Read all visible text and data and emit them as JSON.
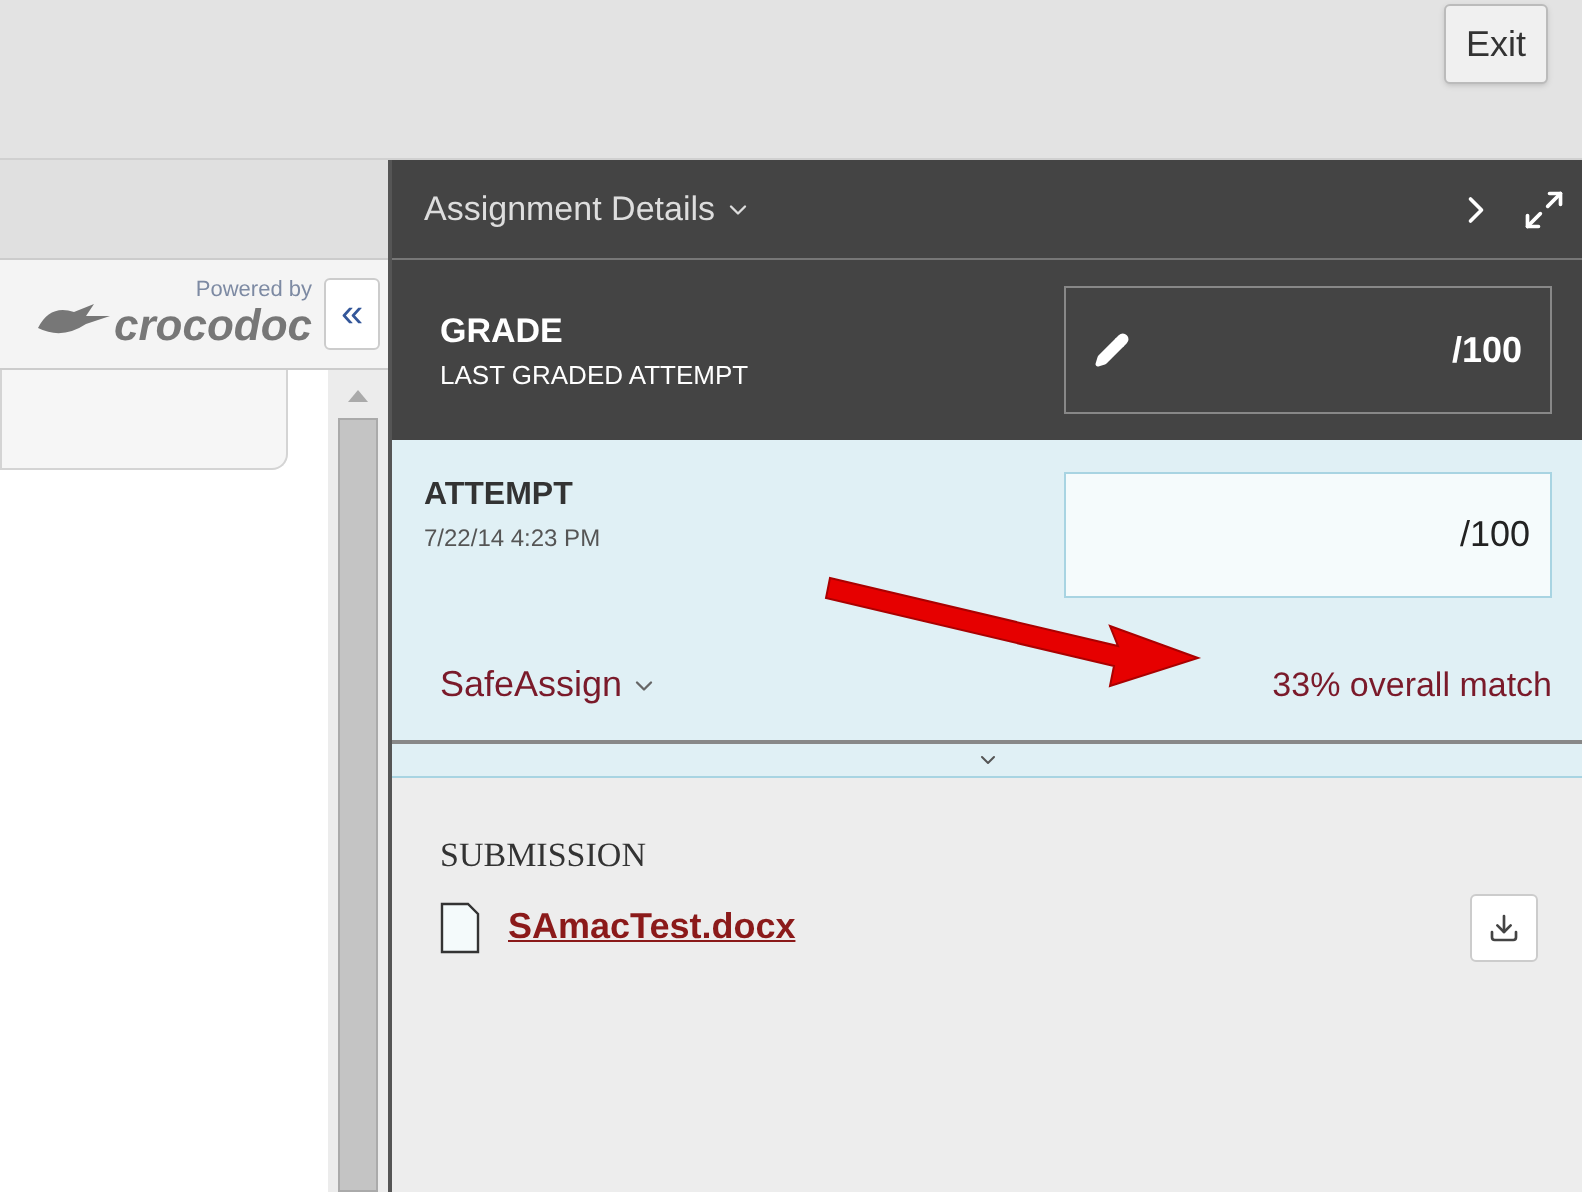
{
  "top_bar": {
    "exit_button": "Exit"
  },
  "viewer": {
    "powered_by": "Powered by",
    "brand": "crocodoc",
    "collapse_button": "«"
  },
  "panel": {
    "title": "Assignment Details",
    "grade": {
      "title": "GRADE",
      "subtitle": "LAST GRADED ATTEMPT",
      "value": "/100"
    },
    "attempt": {
      "title": "ATTEMPT",
      "date": "7/22/14 4:23 PM",
      "value": "/100",
      "tool": "SafeAssign",
      "match": "33% overall match",
      "expanded": false
    },
    "submission": {
      "heading": "SUBMISSION",
      "file": "SAmacTest.docx"
    }
  }
}
